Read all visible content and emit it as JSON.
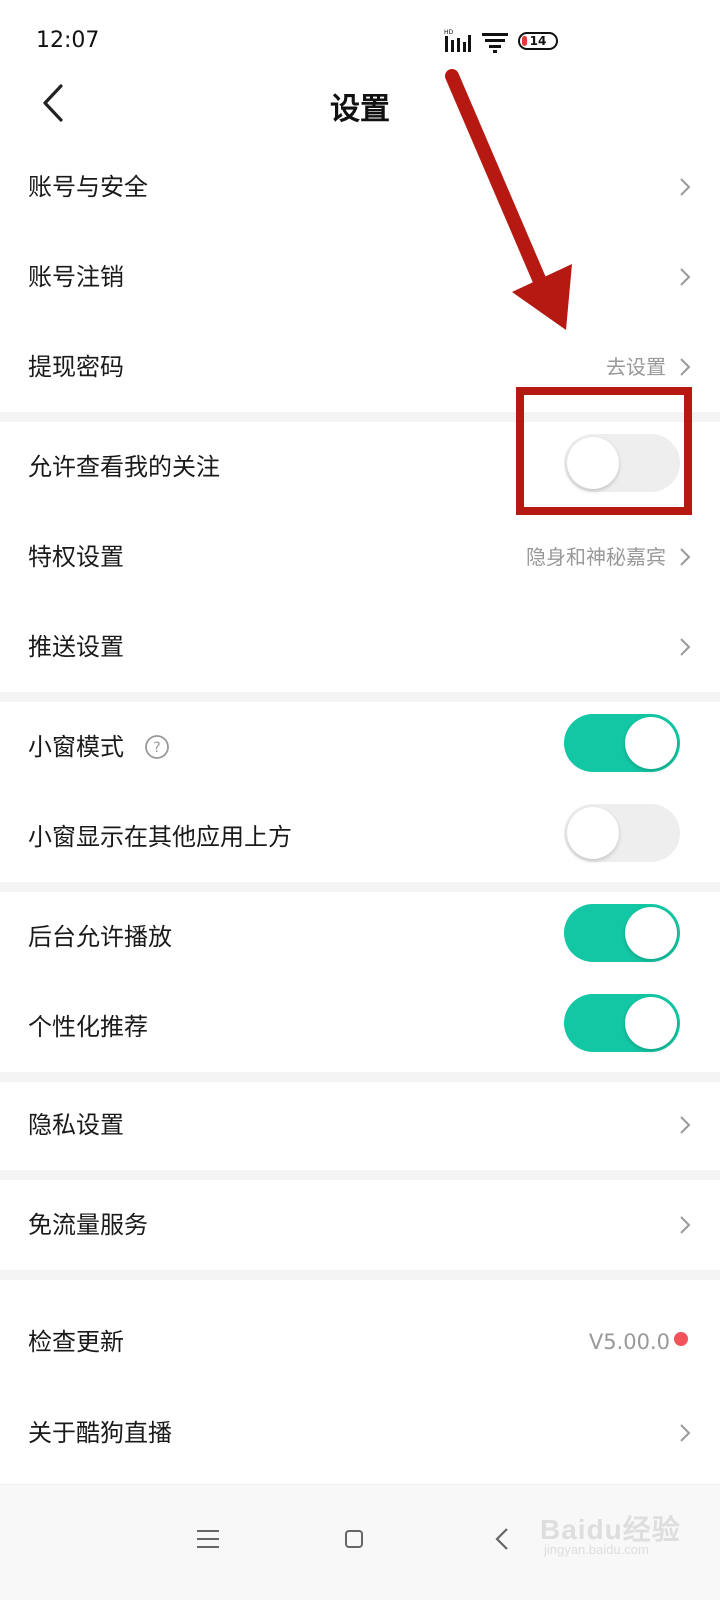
{
  "status_bar": {
    "time": "12:07",
    "battery_level": "14"
  },
  "header": {
    "title": "设置"
  },
  "rows": [
    {
      "label": "账号与安全",
      "value": ""
    },
    {
      "label": "账号注销",
      "value": ""
    },
    {
      "label": "提现密码",
      "value": "去设置"
    },
    {
      "label": "允许查看我的关注",
      "toggle": false
    },
    {
      "label": "特权设置",
      "value": "隐身和神秘嘉宾"
    },
    {
      "label": "推送设置",
      "value": ""
    },
    {
      "label": "小窗模式",
      "toggle": true,
      "help_icon": "question-circle-icon"
    },
    {
      "label": "小窗显示在其他应用上方",
      "toggle": false
    },
    {
      "label": "后台允许播放",
      "toggle": true
    },
    {
      "label": "个性化推荐",
      "toggle": true
    },
    {
      "label": "隐私设置",
      "value": ""
    },
    {
      "label": "免流量服务",
      "value": ""
    },
    {
      "label": "检查更新",
      "value": "V5.00.0",
      "badge": "red-dot"
    },
    {
      "label": "关于酷狗直播",
      "value": ""
    }
  ],
  "colors": {
    "toggle_on": "#14c7a4",
    "toggle_off": "#eeeeee",
    "annotation": "#b51912",
    "badge": "#f2545b"
  },
  "watermark": {
    "brand": "Baidu经验",
    "sub": "jingyan.baidu.com"
  },
  "icons": [
    "back-chevron-icon",
    "chevron-right-icon",
    "question-circle-icon",
    "menu-icon",
    "home-square-icon",
    "nav-back-icon",
    "signal-icon",
    "wifi-icon",
    "battery-icon"
  ]
}
